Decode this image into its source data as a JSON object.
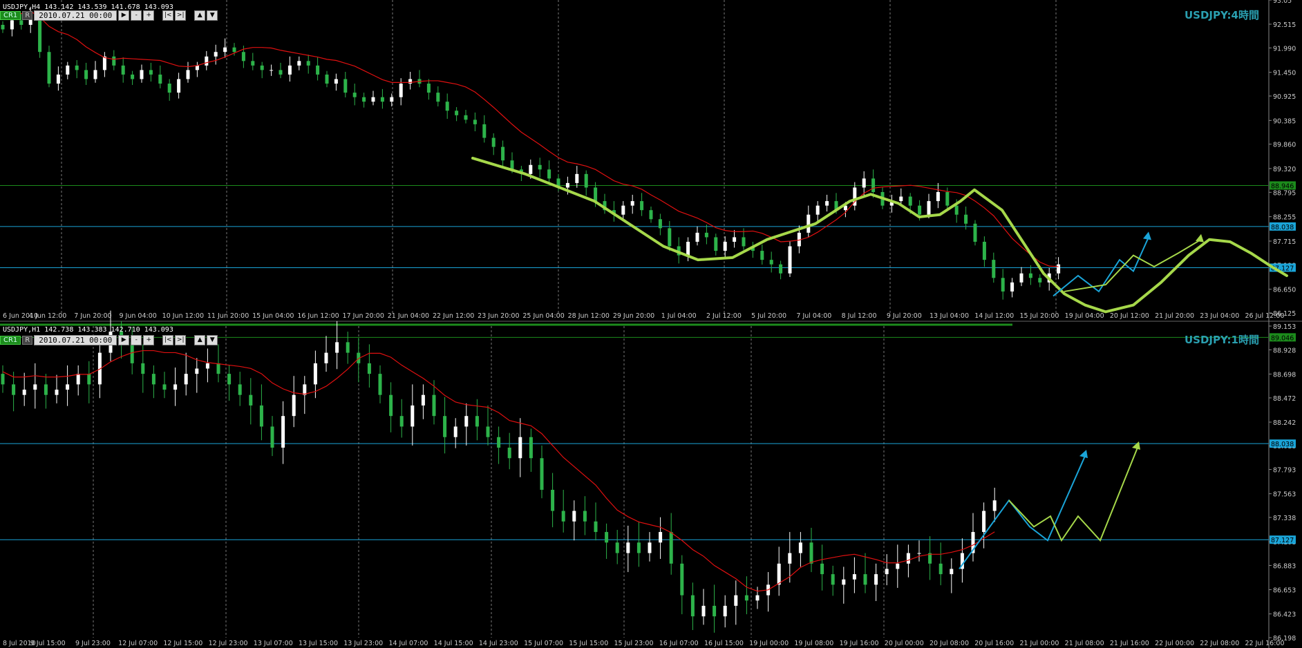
{
  "top_panel": {
    "symbol_info": "USDJPY,H4  143.142 143.539 141.678 143.093",
    "cr_label": "CR1",
    "r_label": "R",
    "date_value": "2010.07.21 00:00",
    "title": "USDJPY:4時間"
  },
  "bottom_panel": {
    "symbol_info": "USDJPY,H1  142.738 143.383 142.710 143.093",
    "cr_label": "CR1",
    "r_label": "R",
    "date_value": "2010.07.21 00:00",
    "title": "USDJPY:1時間"
  },
  "buttons": {
    "play": "▶",
    "minus": "-",
    "plus": "+",
    "first": "|<",
    "last": ">|",
    "up": "▲",
    "down": "▼"
  },
  "colors": {
    "bull": "#ffffff",
    "bear": "#2db34a",
    "ma": "#e01010",
    "level_blue": "#1aa4d8",
    "level_green": "#1c8c1c",
    "wave": "#a6d84a",
    "arrow_blue": "#1aa4d8",
    "grid": "#777777",
    "axis_text": "#cccccc",
    "price_bg_blue": "#1aa4d8"
  },
  "chart_data": [
    {
      "type": "candlestick",
      "title": "USDJPY:4時間",
      "ylim": [
        86.125,
        93.05
      ],
      "y_ticks": [
        "93.05",
        "92.515",
        "91.990",
        "91.450",
        "90.925",
        "90.385",
        "89.860",
        "89.320",
        "88.795",
        "88.255",
        "87.715",
        "87.190",
        "86.650",
        "86.125"
      ],
      "x_ticks": [
        "6 Jun 2010",
        "4 Jun 12:00",
        "7 Jun 20:00",
        "9 Jun 04:00",
        "10 Jun 12:00",
        "11 Jun 20:00",
        "15 Jun 04:00",
        "16 Jun 12:00",
        "17 Jun 20:00",
        "21 Jun 04:00",
        "22 Jun 12:00",
        "23 Jun 20:00",
        "25 Jun 04:00",
        "28 Jun 12:00",
        "29 Jun 20:00",
        "1 Jul 04:00",
        "2 Jul 12:00",
        "5 Jul 20:00",
        "7 Jul 04:00",
        "8 Jul 12:00",
        "9 Jul 20:00",
        "13 Jul 04:00",
        "14 Jul 12:00",
        "15 Jul 20:00",
        "19 Jul 04:00",
        "20 Jul 12:00",
        "21 Jul 20:00",
        "23 Jul 04:00",
        "26 Jul 12:00"
      ],
      "levels": [
        {
          "label": "88.946",
          "value": 88.946,
          "color": "green"
        },
        {
          "label": "88.038",
          "value": 88.038,
          "color": "blue"
        },
        {
          "label": "87.127",
          "value": 87.127,
          "color": "blue"
        }
      ],
      "closes": [
        92.4,
        92.6,
        92.5,
        92.7,
        91.9,
        91.2,
        91.4,
        91.6,
        91.5,
        91.3,
        91.5,
        91.8,
        91.6,
        91.4,
        91.3,
        91.5,
        91.4,
        91.2,
        91.0,
        91.3,
        91.5,
        91.6,
        91.8,
        91.9,
        92.0,
        91.9,
        91.7,
        91.6,
        91.5,
        91.5,
        91.4,
        91.6,
        91.7,
        91.6,
        91.4,
        91.2,
        91.3,
        91.0,
        90.9,
        90.8,
        90.9,
        90.8,
        90.9,
        91.2,
        91.3,
        91.2,
        91.0,
        90.8,
        90.6,
        90.5,
        90.4,
        90.3,
        90.0,
        89.8,
        89.5,
        89.3,
        89.2,
        89.4,
        89.3,
        89.1,
        88.9,
        89.0,
        89.2,
        88.9,
        88.6,
        88.4,
        88.3,
        88.5,
        88.6,
        88.4,
        88.2,
        88.0,
        87.6,
        87.4,
        87.7,
        87.9,
        87.8,
        87.5,
        87.7,
        87.8,
        87.6,
        87.5,
        87.3,
        87.2,
        87.0,
        87.6,
        87.9,
        88.3,
        88.5,
        88.6,
        88.4,
        88.5,
        88.9,
        89.1,
        88.8,
        88.5,
        88.6,
        88.7,
        88.5,
        88.3,
        88.6,
        88.8,
        88.5,
        88.3,
        88.1,
        87.7,
        87.3,
        86.9,
        86.6,
        86.8,
        87.0,
        86.9,
        86.8,
        87.0,
        87.2
      ],
      "ma_note": "red moving average",
      "annotations": [
        "thick green forecast wave",
        "blue arrow up",
        "green zigzag arrow up"
      ]
    },
    {
      "type": "candlestick",
      "title": "USDJPY:1時間",
      "ylim": [
        86.198,
        89.153
      ],
      "y_ticks": [
        "89.153",
        "88.928",
        "88.698",
        "88.472",
        "88.242",
        "88.018",
        "87.793",
        "87.563",
        "87.338",
        "87.108",
        "86.883",
        "86.653",
        "86.423",
        "86.198"
      ],
      "x_ticks": [
        "8 Jul 2010",
        "9 Jul 15:00",
        "9 Jul 23:00",
        "12 Jul 07:00",
        "12 Jul 15:00",
        "12 Jul 23:00",
        "13 Jul 07:00",
        "13 Jul 15:00",
        "13 Jul 23:00",
        "14 Jul 07:00",
        "14 Jul 15:00",
        "14 Jul 23:00",
        "15 Jul 07:00",
        "15 Jul 15:00",
        "15 Jul 23:00",
        "16 Jul 07:00",
        "16 Jul 15:00",
        "19 Jul 00:00",
        "19 Jul 08:00",
        "19 Jul 16:00",
        "20 Jul 00:00",
        "20 Jul 08:00",
        "20 Jul 16:00",
        "21 Jul 00:00",
        "21 Jul 08:00",
        "21 Jul 16:00",
        "22 Jul 00:00",
        "22 Jul 08:00",
        "22 Jul 16:00"
      ],
      "levels": [
        {
          "label": "89.046",
          "value": 89.046,
          "color": "green"
        },
        {
          "label": "88.038",
          "value": 88.038,
          "color": "blue"
        },
        {
          "label": "87.127",
          "value": 87.127,
          "color": "blue"
        }
      ],
      "closes": [
        88.6,
        88.5,
        88.55,
        88.6,
        88.5,
        88.55,
        88.6,
        88.7,
        88.6,
        88.9,
        89.1,
        89.0,
        88.8,
        88.7,
        88.6,
        88.55,
        88.6,
        88.7,
        88.75,
        88.8,
        88.7,
        88.6,
        88.5,
        88.4,
        88.2,
        88.0,
        88.3,
        88.5,
        88.6,
        88.8,
        88.9,
        89.0,
        88.9,
        88.8,
        88.7,
        88.5,
        88.3,
        88.2,
        88.4,
        88.5,
        88.3,
        88.1,
        88.2,
        88.3,
        88.2,
        88.1,
        88.0,
        87.9,
        88.1,
        87.9,
        87.6,
        87.4,
        87.3,
        87.4,
        87.3,
        87.2,
        87.1,
        87.0,
        87.1,
        87.0,
        87.1,
        87.2,
        86.9,
        86.6,
        86.4,
        86.5,
        86.4,
        86.5,
        86.6,
        86.55,
        86.6,
        86.7,
        86.9,
        87.0,
        87.1,
        86.9,
        86.8,
        86.7,
        86.75,
        86.8,
        86.7,
        86.8,
        86.85,
        86.9,
        87.0,
        87.0,
        86.9,
        86.8,
        86.85,
        87.0,
        87.2,
        87.4,
        87.5
      ]
    }
  ]
}
